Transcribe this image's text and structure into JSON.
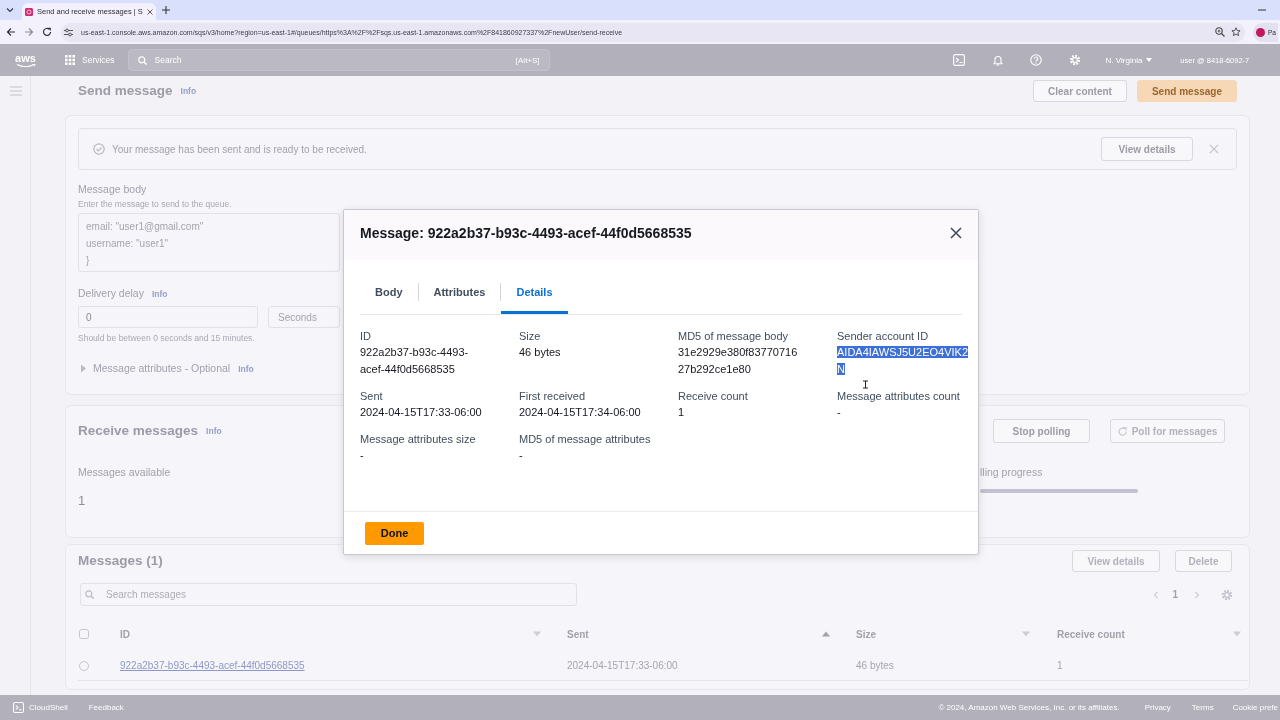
{
  "browser": {
    "tab_title": "Send and receive messages | S",
    "url": "us-east-1.console.aws.amazon.com/sqs/v3/home?region=us-east-1#/queues/https%3A%2F%2Fsqs.us-east-1.amazonaws.com%2F841860927337%2FnewUser/send-receive",
    "profile_label": "Pa"
  },
  "console_header": {
    "logo": "aws",
    "services": "Services",
    "search": {
      "placeholder": "Search",
      "shortcut": "[Alt+S]"
    },
    "region": "N. Virginia",
    "account": "user @ 8418-6092-7"
  },
  "send_message": {
    "title": "Send message",
    "info": "Info",
    "buttons": [
      {
        "label": "Clear content",
        "kind": "normal"
      },
      {
        "label": "Send message",
        "kind": "primary"
      }
    ],
    "alert": {
      "text": "Your message has been sent and is ready to be received.",
      "action": "View details"
    },
    "body": {
      "label": "Message body",
      "description": "Enter the message to send to the queue.",
      "lines": [
        "email: \"user1@gmail.com\"",
        "username: \"user1\"",
        "}"
      ]
    },
    "delivery_delay": {
      "label": "Delivery delay",
      "info": "Info",
      "value": "0",
      "unit": "Seconds",
      "hint": "Should be between 0 seconds and 15 minutes."
    },
    "attributes": {
      "label": "Message attributes - Optional",
      "info": "Info",
      "expanded": false
    }
  },
  "receive_messages": {
    "title": "Receive messages",
    "info": "Info",
    "buttons": [
      {
        "label": "Stop polling",
        "disabled": false
      },
      {
        "label": "Poll for messages",
        "disabled": true
      }
    ],
    "available": {
      "label": "Messages available",
      "value": "1"
    },
    "polling": {
      "label": "lling progress",
      "level": 1
    }
  },
  "messages": {
    "title": "Messages (1)",
    "buttons": [
      "View details",
      "Delete"
    ],
    "search": {
      "placeholder": "Search messages"
    },
    "page": "1",
    "all_checked": false,
    "columns": [
      {
        "label": "ID",
        "sorted": false
      },
      {
        "label": "Sent",
        "sorted": true
      },
      {
        "label": "Size",
        "sorted": false
      },
      {
        "label": "Receive count",
        "sorted": false
      }
    ],
    "rows": [
      {
        "selected": false,
        "cells": [
          "922a2b37-b93c-4493-acef-44f0d5668535",
          "2024-04-15T17:33-06:00",
          "46 bytes",
          "1"
        ]
      }
    ]
  },
  "footer": {
    "cloudshell": "CloudShell",
    "feedback": "Feedback",
    "copyright": "© 2024, Amazon Web Services, Inc. or its affiliates.",
    "links": [
      "Privacy",
      "Terms",
      "Cookie prefe"
    ]
  },
  "modal": {
    "title": "Message: 922a2b37-b93c-4493-acef-44f0d5668535",
    "tabs": [
      {
        "label": "Body",
        "selected": false
      },
      {
        "label": "Attributes",
        "selected": false
      },
      {
        "label": "Details",
        "selected": true
      }
    ],
    "fields": [
      {
        "label": "ID",
        "value": "922a2b37-b93c-4493-acef-44f0d5668535",
        "highlighted": false
      },
      {
        "label": "Size",
        "value": "46 bytes",
        "highlighted": false
      },
      {
        "label": "MD5 of message body",
        "value": "31e2929e380f8377071627b292ce1e80",
        "highlighted": false
      },
      {
        "label": "Sender account ID",
        "value": "AIDA4IAWSJ5U2EO4VIK2N",
        "highlighted": true
      },
      {
        "label": "Sent",
        "value": "2024-04-15T17:33-06:00",
        "highlighted": false
      },
      {
        "label": "First received",
        "value": "2024-04-15T17:34-06:00",
        "highlighted": false
      },
      {
        "label": "Receive count",
        "value": "1",
        "highlighted": false
      },
      {
        "label": "Message attributes count",
        "value": "-",
        "highlighted": false
      },
      {
        "label": "Message attributes size",
        "value": "-",
        "highlighted": false
      },
      {
        "label": "MD5 of message attributes",
        "value": "-",
        "highlighted": false
      }
    ],
    "button": "Done"
  }
}
